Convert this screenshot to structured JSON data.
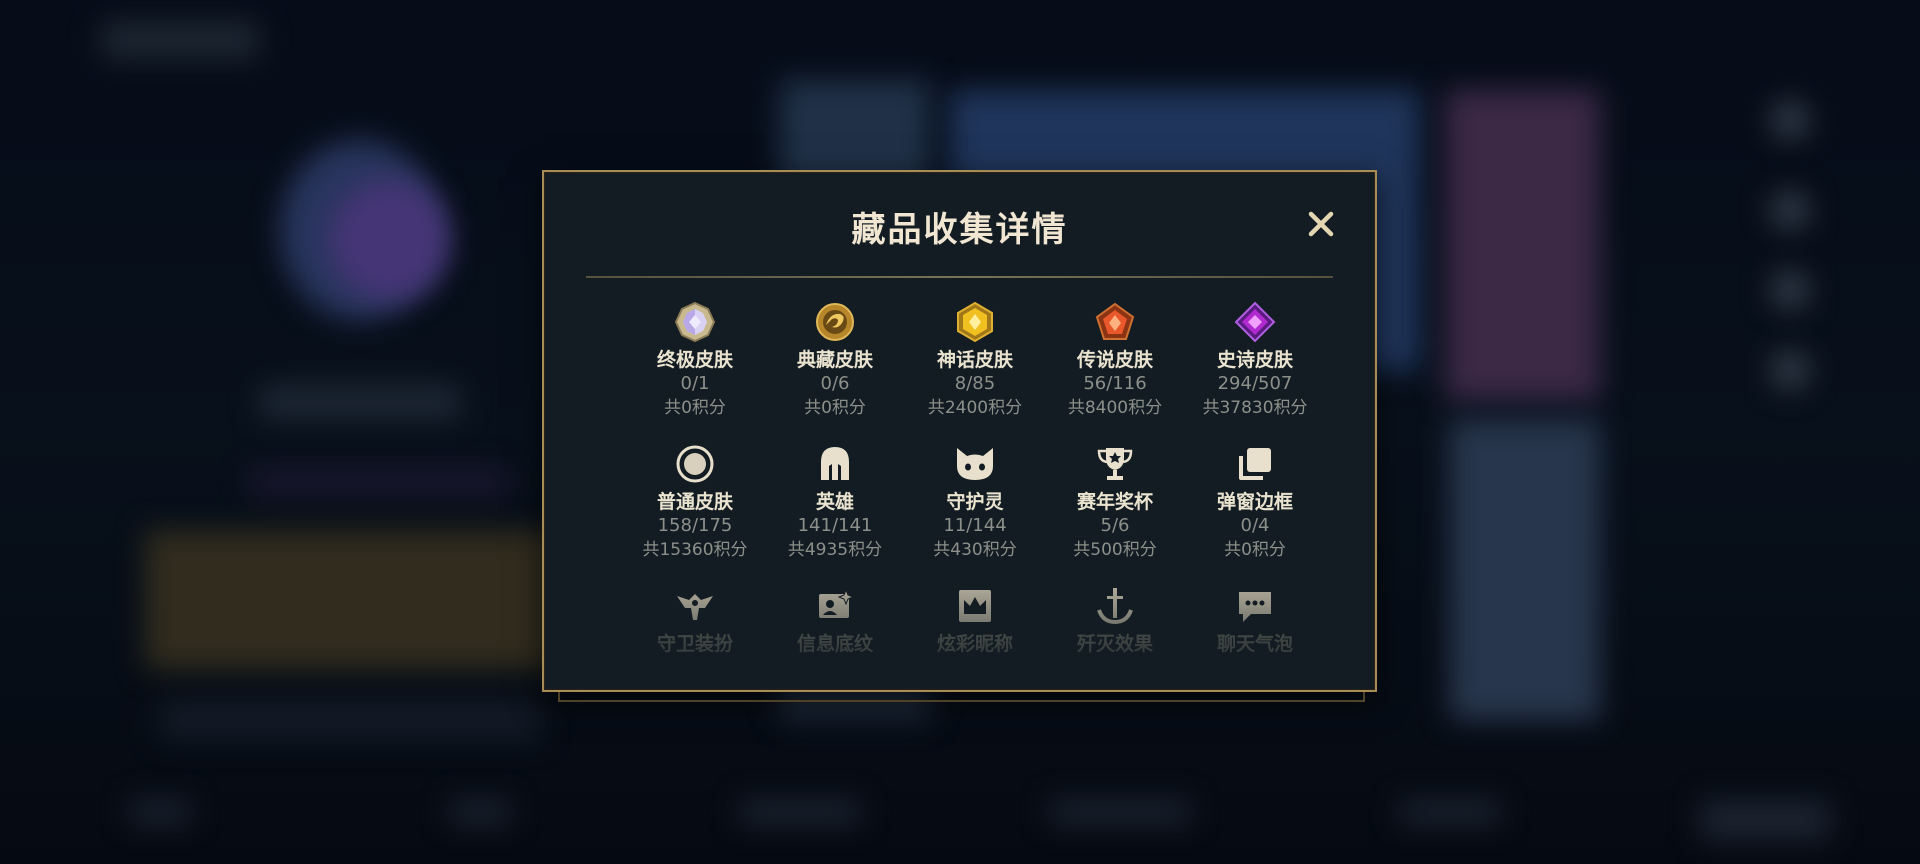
{
  "modal": {
    "title": "藏品收集详情",
    "close_icon": "close-x-icon"
  },
  "rows": [
    [
      {
        "name": "终极皮肤",
        "count": "0/1",
        "points": "共0积分",
        "icon": "ultimate-gem-icon"
      },
      {
        "name": "典藏皮肤",
        "count": "0/6",
        "points": "共0积分",
        "icon": "dragon-medal-icon"
      },
      {
        "name": "神话皮肤",
        "count": "8/85",
        "points": "共2400积分",
        "icon": "mythic-gem-icon"
      },
      {
        "name": "传说皮肤",
        "count": "56/116",
        "points": "共8400积分",
        "icon": "legendary-gem-icon"
      },
      {
        "name": "史诗皮肤",
        "count": "294/507",
        "points": "共37830积分",
        "icon": "epic-gem-icon"
      }
    ],
    [
      {
        "name": "普通皮肤",
        "count": "158/175",
        "points": "共15360积分",
        "icon": "circle-ring-icon"
      },
      {
        "name": "英雄",
        "count": "141/141",
        "points": "共4935积分",
        "icon": "helmet-icon"
      },
      {
        "name": "守护灵",
        "count": "11/144",
        "points": "共430积分",
        "icon": "cat-face-icon"
      },
      {
        "name": "赛年奖杯",
        "count": "5/6",
        "points": "共500积分",
        "icon": "trophy-icon"
      },
      {
        "name": "弹窗边框",
        "count": "0/4",
        "points": "共0积分",
        "icon": "stacked-frames-icon"
      }
    ],
    [
      {
        "name": "守卫装扮",
        "icon": "ward-icon"
      },
      {
        "name": "信息底纹",
        "icon": "id-card-sparkle-icon"
      },
      {
        "name": "炫彩昵称",
        "icon": "crown-frame-icon"
      },
      {
        "name": "歼灭效果",
        "icon": "anchor-sword-icon"
      },
      {
        "name": "聊天气泡",
        "icon": "chat-bubble-icon"
      }
    ]
  ],
  "colors": {
    "modal_bg": "#121c22",
    "border_gold": "#a88c58",
    "title": "#f0e6d2",
    "muted": "#8d8f8a"
  }
}
